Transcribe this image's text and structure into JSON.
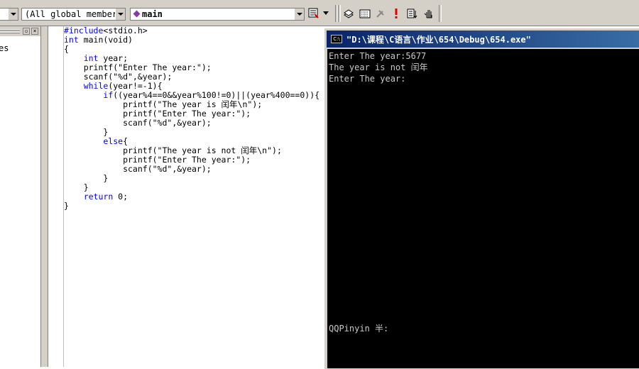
{
  "toolbar": {
    "class_combo": "",
    "member_combo": "(All global member",
    "function_combo": "main",
    "icons": [
      "build-icon",
      "class-wizard-icon",
      "compile-stop-icon",
      "execute-icon",
      "go-icon",
      "breakpoint-icon"
    ]
  },
  "left_panel": {
    "item_label": "es"
  },
  "editor": {
    "lines": [
      "#include<stdio.h>",
      "int main(void)",
      "{",
      "    int year;",
      "    printf(\"Enter The year:\");",
      "    scanf(\"%d\",&year);",
      "    while(year!=-1){",
      "        if((year%4==0&&year%100!=0)||(year%400==0)){",
      "            printf(\"The year is 闰年\\n\");",
      "            printf(\"Enter The year:\");",
      "            scanf(\"%d\",&year);",
      "        }",
      "        else{",
      "            printf(\"The year is not 闰年\\n\");",
      "            printf(\"Enter The year:\");",
      "            scanf(\"%d\",&year);",
      "        }",
      "    }",
      "    return 0;",
      "}"
    ]
  },
  "console": {
    "title": "\"D:\\课程\\C语言\\作业\\654\\Debug\\654.exe\"",
    "icon_label": "C:\\",
    "output": [
      "Enter The year:5677",
      "The year is not 闰年",
      "Enter The year:"
    ],
    "ime_status": "QQPinyin 半:"
  },
  "colors": {
    "console_title_bar": "#0a246a",
    "keyword": "#0000ff",
    "console_bg": "#000000"
  }
}
